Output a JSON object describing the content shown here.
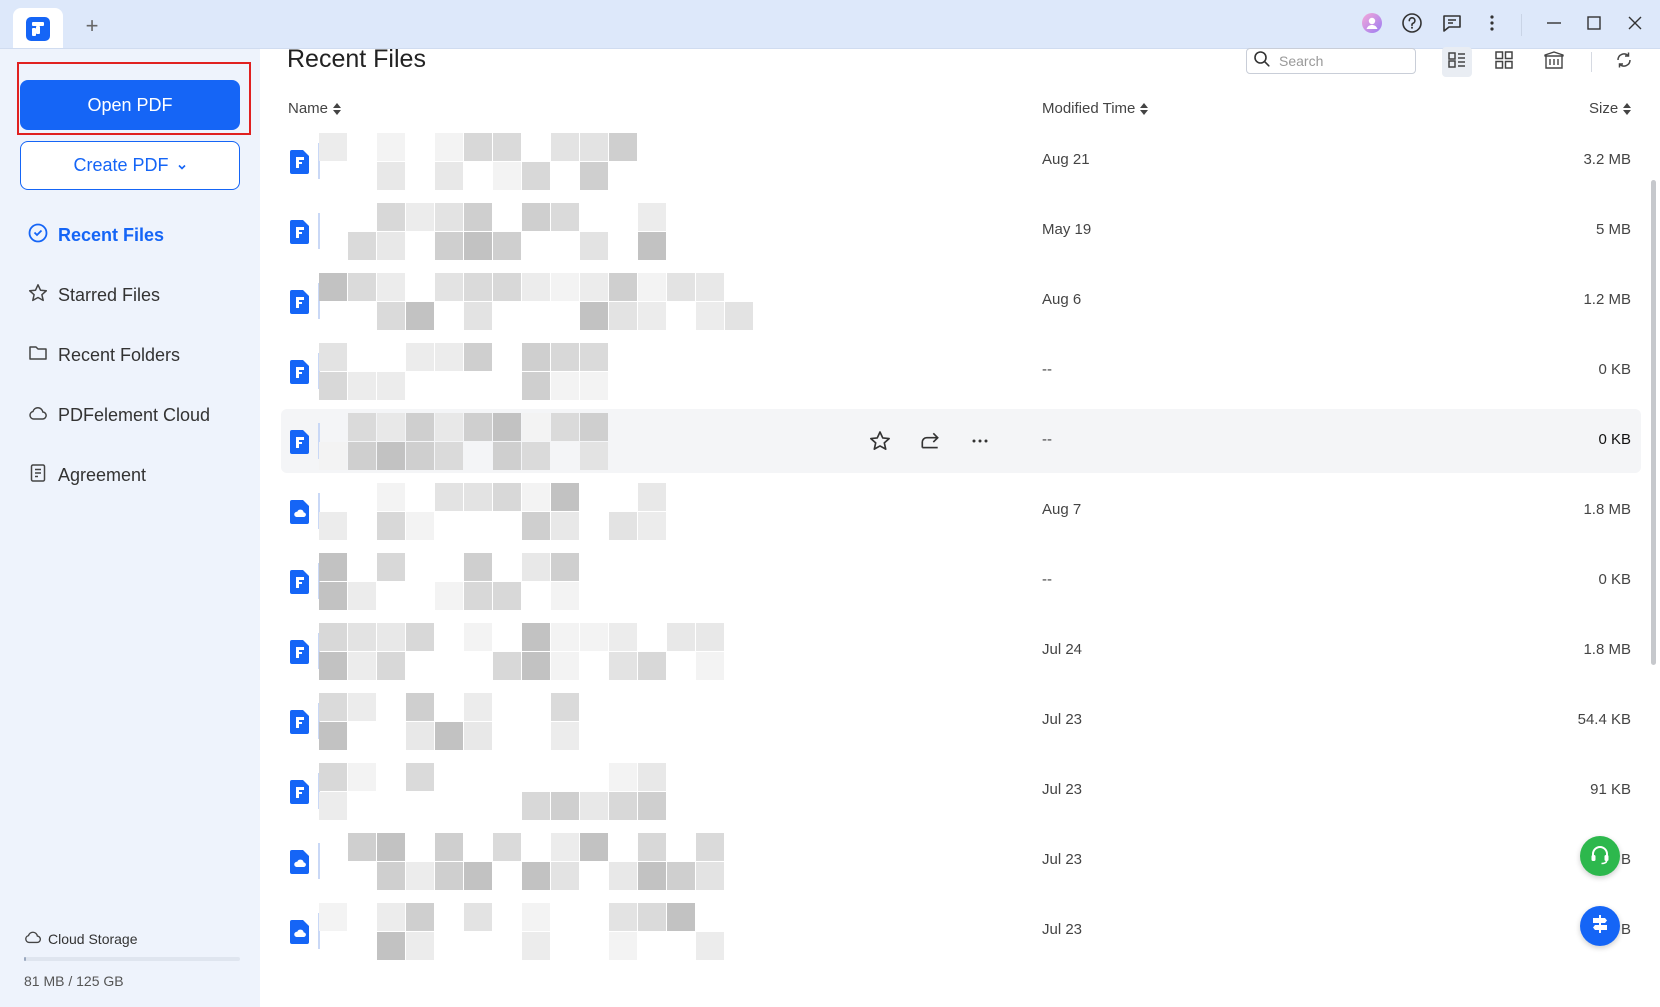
{
  "titlebar": {
    "new_tab": "+",
    "icons": [
      "avatar-icon",
      "help-icon",
      "feedback-icon",
      "more-vertical-icon",
      "minimize-icon",
      "maximize-icon",
      "close-icon"
    ]
  },
  "sidebar": {
    "open_pdf": "Open PDF",
    "create_pdf": "Create PDF",
    "nav": [
      {
        "label": "Recent Files",
        "icon": "clock-icon",
        "active": true
      },
      {
        "label": "Starred Files",
        "icon": "star-icon",
        "active": false
      },
      {
        "label": "Recent Folders",
        "icon": "folder-icon",
        "active": false
      },
      {
        "label": "PDFelement Cloud",
        "icon": "cloud-icon",
        "active": false
      },
      {
        "label": "Agreement",
        "icon": "document-icon",
        "active": false
      }
    ],
    "storage": {
      "label": "Cloud Storage",
      "usage": "81 MB / 125 GB",
      "used_fraction": 0.0006
    }
  },
  "main": {
    "title": "Recent Files",
    "search_placeholder": "Search",
    "columns": {
      "name": "Name",
      "modified": "Modified Time",
      "size": "Size"
    },
    "rows": [
      {
        "modified": "Aug 21",
        "size": "3.2 MB",
        "icon": "pdf-file-icon"
      },
      {
        "modified": "May 19",
        "size": "5 MB",
        "icon": "pdf-file-icon"
      },
      {
        "modified": "Aug 6",
        "size": "1.2 MB",
        "icon": "pdf-file-icon"
      },
      {
        "modified": "--",
        "size": "0 KB",
        "icon": "pdf-file-icon"
      },
      {
        "modified": "--",
        "size": "0 KB",
        "icon": "pdf-file-icon",
        "hovered": true
      },
      {
        "modified": "Aug 7",
        "size": "1.8 MB",
        "icon": "cloud-file-icon"
      },
      {
        "modified": "--",
        "size": "0 KB",
        "icon": "pdf-file-icon"
      },
      {
        "modified": "Jul 24",
        "size": "1.8 MB",
        "icon": "pdf-file-icon"
      },
      {
        "modified": "Jul 23",
        "size": "54.4 KB",
        "icon": "pdf-file-icon"
      },
      {
        "modified": "Jul 23",
        "size": "91 KB",
        "icon": "pdf-file-icon"
      },
      {
        "modified": "Jul 23",
        "size": "B",
        "icon": "cloud-file-icon"
      },
      {
        "modified": "Jul 23",
        "size": "B",
        "icon": "cloud-file-icon"
      }
    ]
  },
  "colors": {
    "accent": "#1565f6",
    "titlebar_bg": "#dde8fa",
    "sidebar_bg": "#eef3fc",
    "highlight_border": "#e02020",
    "support_fab": "#2db84d",
    "assistant_fab": "#1565f6"
  }
}
